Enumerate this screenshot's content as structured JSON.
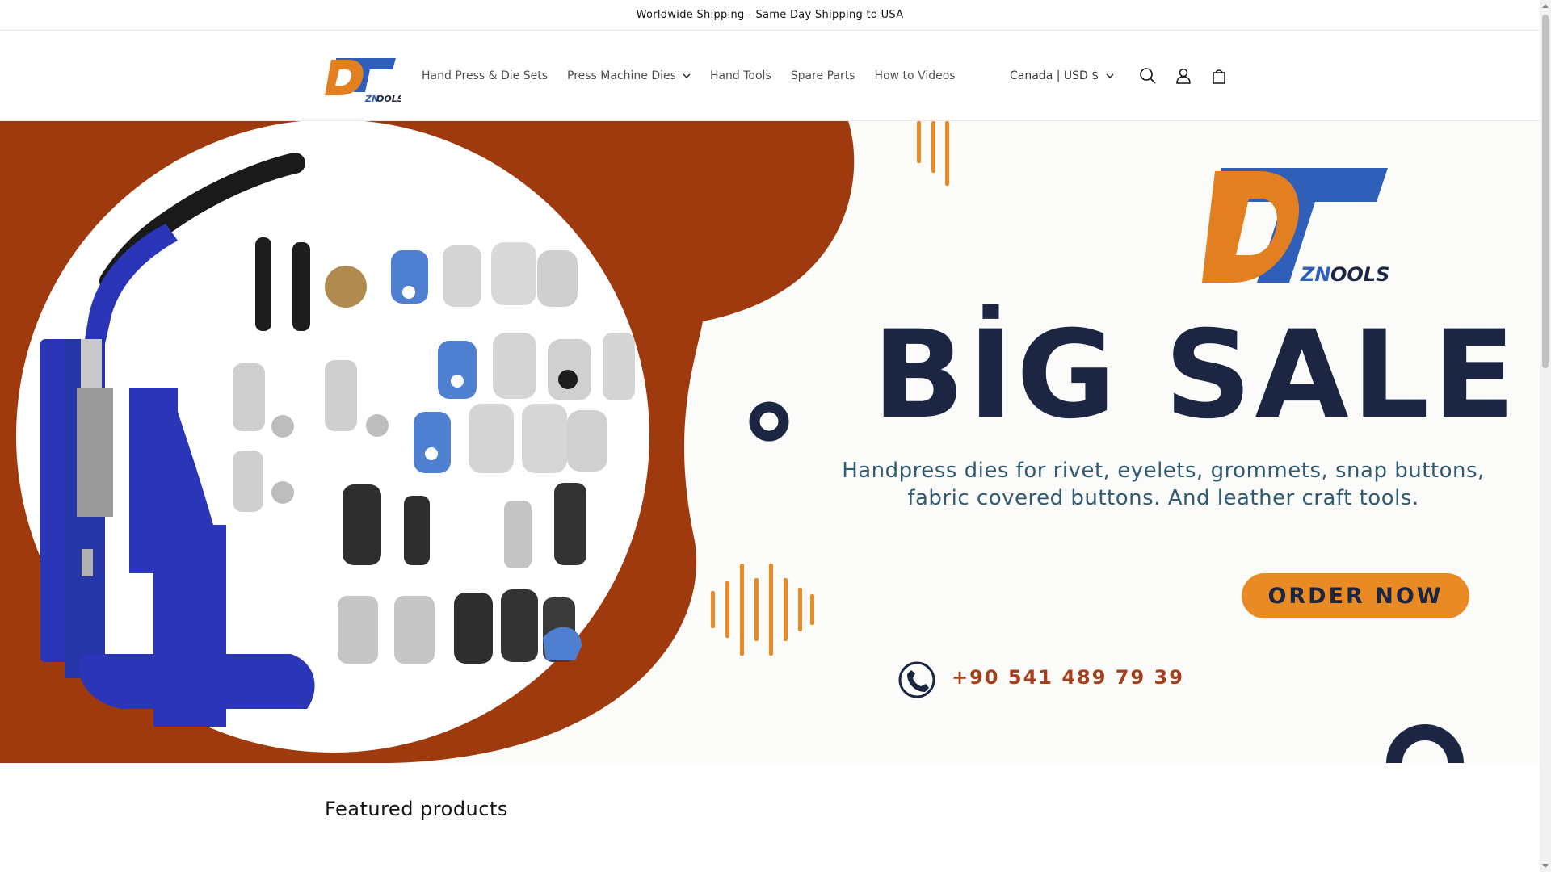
{
  "announcement": {
    "text": "Worldwide Shipping - Same Day Shipping to USA"
  },
  "header": {
    "logo": {
      "main": "DT",
      "sub": "ZN",
      "tail": "OOLS"
    },
    "nav": [
      {
        "label": "Hand Press & Die Sets"
      },
      {
        "label": "Press Machine Dies"
      },
      {
        "label": "Hand Tools"
      },
      {
        "label": "Spare Parts"
      },
      {
        "label": "How to Videos"
      }
    ],
    "locale": "Canada | USD $",
    "icons": [
      "search-icon",
      "account-icon",
      "cart-icon"
    ]
  },
  "hero": {
    "headline": "BİG SALE",
    "subtitle": "Handpress dies for rivet, eyelets, grommets, snap buttons, fabric covered buttons. And leather craft tools.",
    "cta": "ORDER NOW",
    "phone": "+90 541 489 79 39",
    "colors": {
      "rust": "#9e3a0e",
      "navy": "#1c2541",
      "orange": "#e98a24",
      "press_blue": "#2b35b8"
    }
  },
  "featured": {
    "title": "Featured products"
  }
}
